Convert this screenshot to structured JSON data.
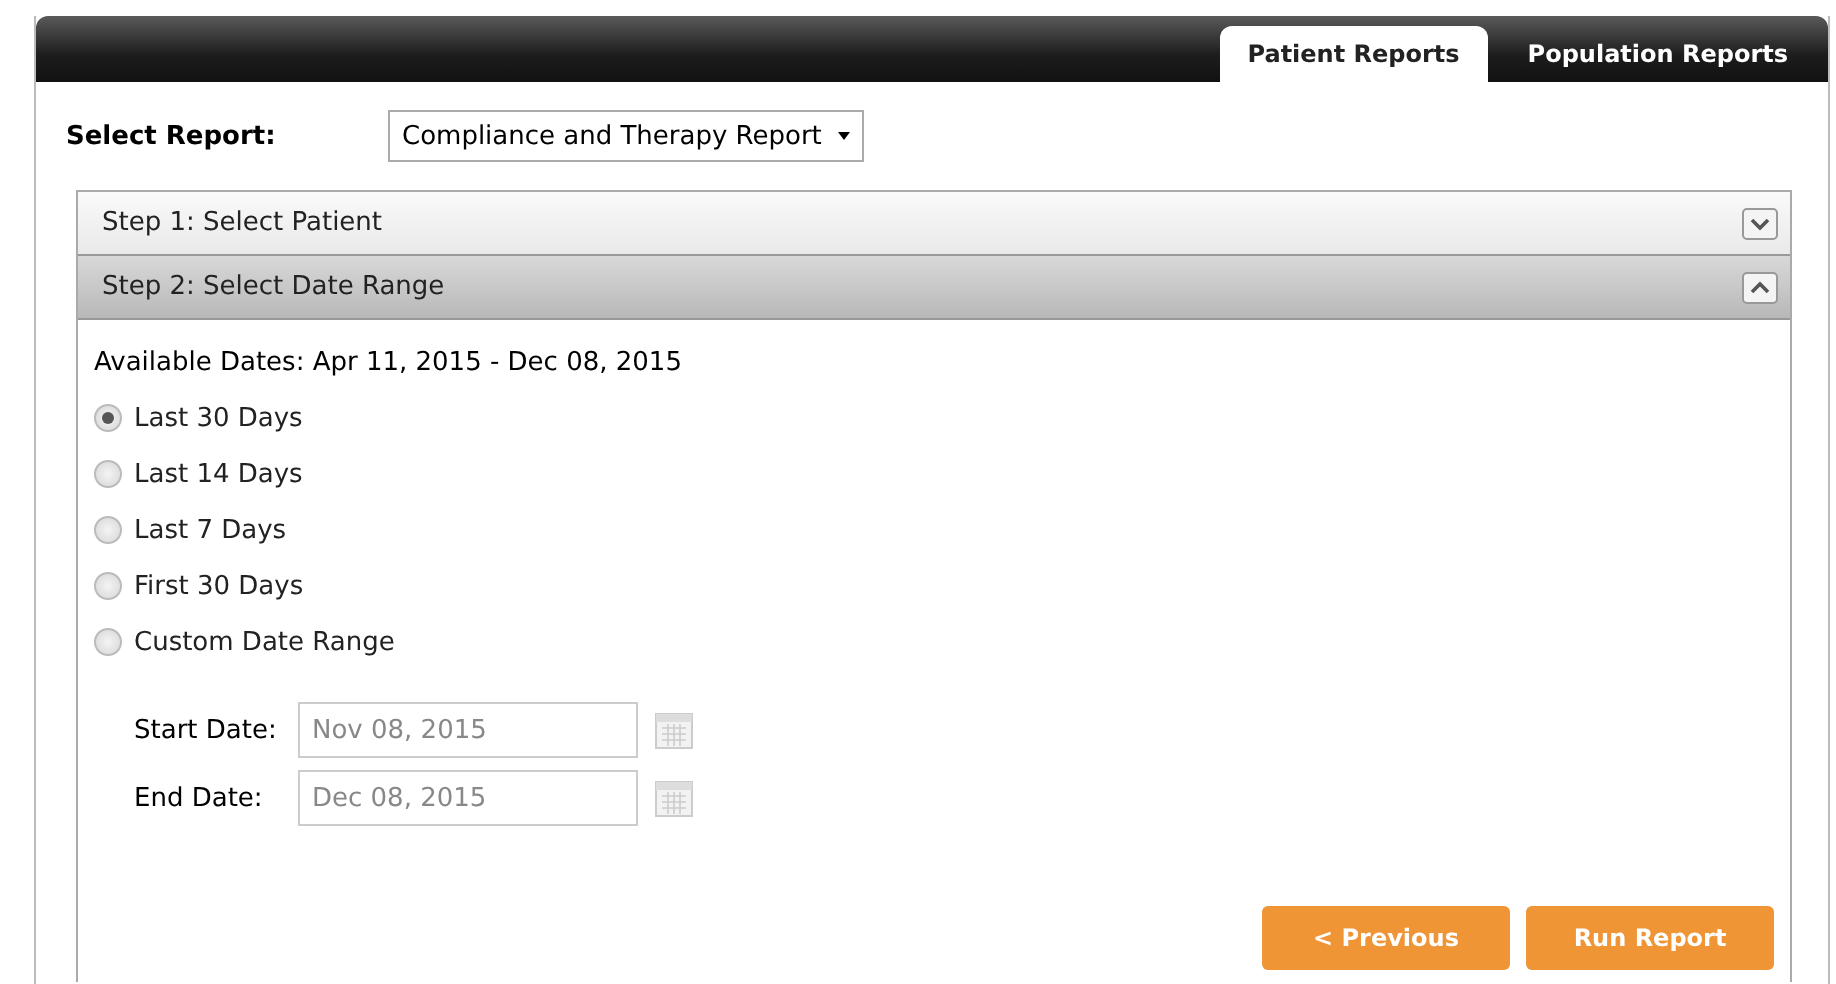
{
  "tabs": [
    {
      "label": "Patient Reports",
      "selected": true
    },
    {
      "label": "Population Reports",
      "selected": false
    }
  ],
  "select_report": {
    "label": "Select Report:",
    "value": "Compliance and Therapy Report"
  },
  "steps": [
    {
      "label": "Step 1: Select Patient",
      "expanded": false
    },
    {
      "label": "Step 2: Select Date Range",
      "expanded": true
    }
  ],
  "available_dates": "Available Dates: Apr 11, 2015 - Dec 08, 2015",
  "date_options": [
    {
      "label": "Last 30 Days",
      "selected": true
    },
    {
      "label": "Last 14 Days",
      "selected": false
    },
    {
      "label": "Last 7 Days",
      "selected": false
    },
    {
      "label": "First 30 Days",
      "selected": false
    },
    {
      "label": "Custom Date Range",
      "selected": false
    }
  ],
  "date_fields": [
    {
      "label": "Start Date:",
      "value": "Nov 08, 2015",
      "disabled": true
    },
    {
      "label": "End Date:",
      "value": "Dec 08, 2015",
      "disabled": true
    }
  ],
  "buttons": [
    "< Previous",
    "Run Report"
  ]
}
